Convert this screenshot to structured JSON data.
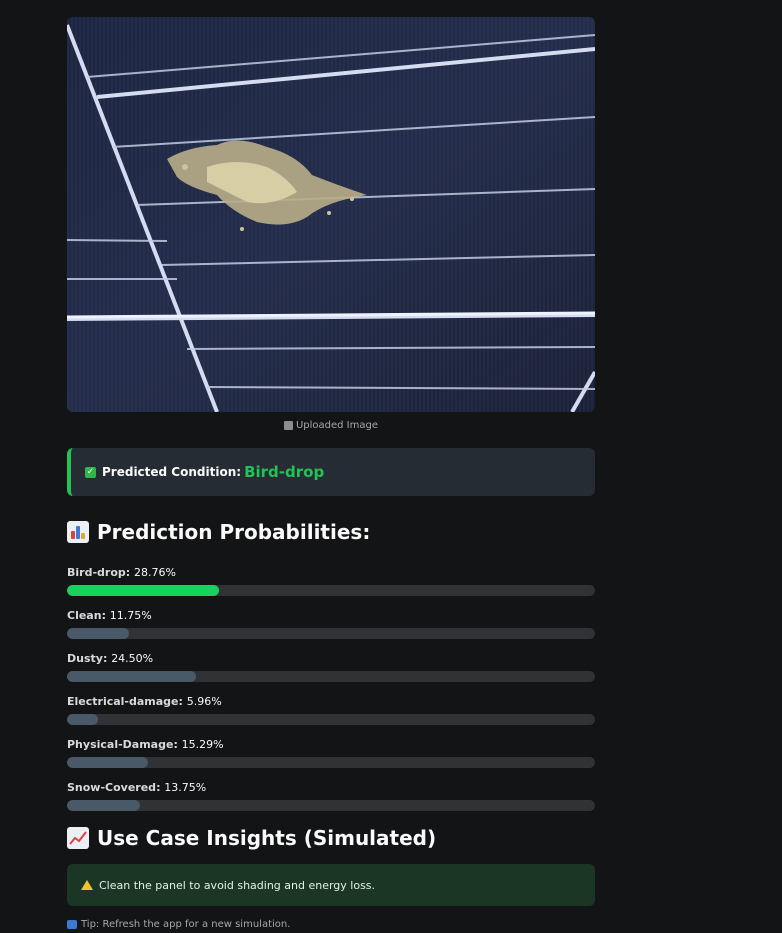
{
  "image": {
    "caption": "Uploaded Image",
    "caption_icon": "frame-icon"
  },
  "prediction": {
    "label": "Predicted Condition",
    "colon": ":",
    "value": "Bird-drop",
    "icon": "check-icon",
    "accent": "#21c354"
  },
  "probabilities": {
    "heading": "Prediction Probabilities:",
    "icon": "bar-chart-icon",
    "items": [
      {
        "name": "Bird-drop",
        "value_text": "28.76%",
        "value": 28.76
      },
      {
        "name": "Clean",
        "value_text": "11.75%",
        "value": 11.75
      },
      {
        "name": "Dusty",
        "value_text": "24.50%",
        "value": 24.5
      },
      {
        "name": "Electrical-damage",
        "value_text": "5.96%",
        "value": 5.96
      },
      {
        "name": "Physical-Damage",
        "value_text": "15.29%",
        "value": 15.29
      },
      {
        "name": "Snow-Covered",
        "value_text": "13.75%",
        "value": 13.75
      }
    ],
    "top_color": "#19d15e",
    "other_color": "#4a5968"
  },
  "insights": {
    "heading": "Use Case Insights (Simulated)",
    "icon": "trend-chart-icon",
    "message": "Clean the panel to avoid shading and energy loss.",
    "message_icon": "warning-icon"
  },
  "tip": {
    "text": "Tip: Refresh the app for a new simulation.",
    "icon": "info-icon"
  }
}
